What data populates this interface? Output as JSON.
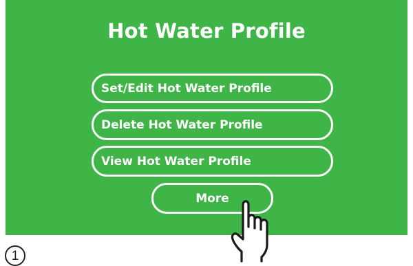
{
  "screen": {
    "title": "Hot Water Profile",
    "background_color": "#3fb548",
    "buttons": [
      {
        "label": "Set/Edit Hot Water Profile"
      },
      {
        "label": "Delete Hot Water Profile"
      },
      {
        "label": "View Hot Water Profile"
      },
      {
        "label": "More"
      }
    ]
  },
  "step": {
    "number": "1"
  },
  "icons": {
    "pointer": "hand-pointer-icon"
  }
}
